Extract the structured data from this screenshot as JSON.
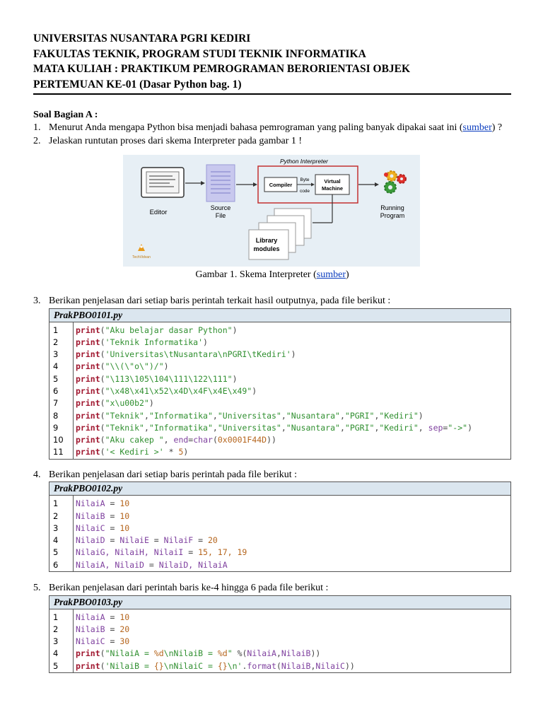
{
  "header": {
    "line1": "UNIVERSITAS NUSANTARA PGRI KEDIRI",
    "line2": "FAKULTAS TEKNIK, PROGRAM STUDI TEKNIK INFORMATIKA",
    "line3": "MATA KULIAH : PRAKTIKUM PEMROGRAMAN BERORIENTASI OBJEK",
    "line4": "PERTEMUAN KE-01 (Dasar Python bag. 1)"
  },
  "section_title": "Soal Bagian A :",
  "q1": {
    "num": "1.",
    "text": "Menurut Anda mengapa Python bisa menjadi bahasa pemrograman yang paling banyak dipakai saat ini (",
    "link": "sumber",
    "tail": ") ?"
  },
  "q2": {
    "num": "2.",
    "text": "Jelaskan runtutan proses dari skema Interpreter pada gambar 1 !"
  },
  "figure": {
    "title": "Python Interpreter",
    "editor": "Editor",
    "source": "Source",
    "file": "File",
    "compiler": "Compiler",
    "byte": "Byte",
    "code": "code",
    "virtual": "Virtual",
    "machine": "Machine",
    "running": "Running",
    "program": "Program",
    "library": "Library",
    "modules": "modules",
    "brand": "TechVidvan",
    "colors": {
      "gear1": "#e0302b",
      "gear2": "#3a9b3a",
      "gear3": "#f0b020",
      "bg": "#e7eff5",
      "box": "#c43030"
    }
  },
  "caption": {
    "text": "Gambar 1. Skema Interpreter (",
    "link": "sumber",
    "tail": ")"
  },
  "q3": {
    "num": "3.",
    "text": "Berikan penjelasan dari setiap baris perintah terkait hasil outputnya, pada file berikut :"
  },
  "q4": {
    "num": "4.",
    "text": "Berikan penjelasan dari setiap baris perintah pada file berikut :"
  },
  "q5": {
    "num": "5.",
    "text": "Berikan penjelasan dari perintah baris ke-4 hingga 6 pada file berikut :"
  },
  "code1": {
    "filename": "PrakPBO0101.py",
    "lines": [
      [
        "1",
        [
          [
            "kw",
            "print"
          ],
          [
            "op",
            "("
          ],
          [
            "str",
            "\"Aku belajar dasar Python\""
          ],
          [
            "op",
            ")"
          ]
        ]
      ],
      [
        "2",
        [
          [
            "kw",
            "print"
          ],
          [
            "op",
            "("
          ],
          [
            "str",
            "'Teknik Informatika'"
          ],
          [
            "op",
            ")"
          ]
        ]
      ],
      [
        "3",
        [
          [
            "kw",
            "print"
          ],
          [
            "op",
            "("
          ],
          [
            "str",
            "'Universitas\\tNusantara\\nPGRI\\tKediri'"
          ],
          [
            "op",
            ")"
          ]
        ]
      ],
      [
        "4",
        [
          [
            "kw",
            "print"
          ],
          [
            "op",
            "("
          ],
          [
            "str",
            "\"\\\\(\\\"o\\\")/\""
          ],
          [
            "op",
            ")"
          ]
        ]
      ],
      [
        "5",
        [
          [
            "kw",
            "print"
          ],
          [
            "op",
            "("
          ],
          [
            "str",
            "\"\\113\\105\\104\\111\\122\\111\""
          ],
          [
            "op",
            ")"
          ]
        ]
      ],
      [
        "6",
        [
          [
            "kw",
            "print"
          ],
          [
            "op",
            "("
          ],
          [
            "str",
            "\"\\x48\\x41\\x52\\x4D\\x4F\\x4E\\x49\""
          ],
          [
            "op",
            ")"
          ]
        ]
      ],
      [
        "7",
        [
          [
            "kw",
            "print"
          ],
          [
            "op",
            "("
          ],
          [
            "str",
            "\"x\\u00b2\""
          ],
          [
            "op",
            ")"
          ]
        ]
      ],
      [
        "8",
        [
          [
            "kw",
            "print"
          ],
          [
            "op",
            "("
          ],
          [
            "str",
            "\"Teknik\""
          ],
          [
            "op",
            ","
          ],
          [
            "str",
            "\"Informatika\""
          ],
          [
            "op",
            ","
          ],
          [
            "str",
            "\"Universitas\""
          ],
          [
            "op",
            ","
          ],
          [
            "str",
            "\"Nusantara\""
          ],
          [
            "op",
            ","
          ],
          [
            "str",
            "\"PGRI\""
          ],
          [
            "op",
            ","
          ],
          [
            "str",
            "\"Kediri\""
          ],
          [
            "op",
            ")"
          ]
        ]
      ],
      [
        "9",
        [
          [
            "kw",
            "print"
          ],
          [
            "op",
            "("
          ],
          [
            "str",
            "\"Teknik\""
          ],
          [
            "op",
            ","
          ],
          [
            "str",
            "\"Informatika\""
          ],
          [
            "op",
            ","
          ],
          [
            "str",
            "\"Universitas\""
          ],
          [
            "op",
            ","
          ],
          [
            "str",
            "\"Nusantara\""
          ],
          [
            "op",
            ","
          ],
          [
            "str",
            "\"PGRI\""
          ],
          [
            "op",
            ","
          ],
          [
            "str",
            "\"Kediri\""
          ],
          [
            "op",
            ", "
          ],
          [
            "var",
            "sep"
          ],
          [
            "op",
            "="
          ],
          [
            "str",
            "\"->\""
          ],
          [
            "op",
            ")"
          ]
        ]
      ],
      [
        "10",
        [
          [
            "kw",
            "print"
          ],
          [
            "op",
            "("
          ],
          [
            "str",
            "\"Aku cakep \""
          ],
          [
            "op",
            ", "
          ],
          [
            "var",
            "end"
          ],
          [
            "op",
            "="
          ],
          [
            "var",
            "char"
          ],
          [
            "op",
            "("
          ],
          [
            "numc",
            "0x0001F44D"
          ],
          [
            "op",
            "))"
          ]
        ]
      ],
      [
        "11",
        [
          [
            "kw",
            "print"
          ],
          [
            "op",
            "("
          ],
          [
            "str",
            "'< Kediri >'"
          ],
          [
            "op",
            " * "
          ],
          [
            "numc",
            "5"
          ],
          [
            "op",
            ")"
          ]
        ]
      ]
    ]
  },
  "code2": {
    "filename": "PrakPBO0102.py",
    "lines": [
      [
        "1",
        [
          [
            "var",
            "NilaiA"
          ],
          [
            "op",
            " = "
          ],
          [
            "numc",
            "10"
          ]
        ]
      ],
      [
        "2",
        [
          [
            "var",
            "NilaiB"
          ],
          [
            "op",
            " = "
          ],
          [
            "numc",
            "10"
          ]
        ]
      ],
      [
        "3",
        [
          [
            "var",
            "NilaiC"
          ],
          [
            "op",
            " = "
          ],
          [
            "numc",
            "10"
          ]
        ]
      ],
      [
        "4",
        [
          [
            "var",
            "NilaiD"
          ],
          [
            "op",
            " = "
          ],
          [
            "var",
            "NilaiE"
          ],
          [
            "op",
            " = "
          ],
          [
            "var",
            "NilaiF"
          ],
          [
            "op",
            " = "
          ],
          [
            "numc",
            "20"
          ]
        ]
      ],
      [
        "5",
        [
          [
            "var",
            "NilaiG, NilaiH, NilaiI"
          ],
          [
            "op",
            " = "
          ],
          [
            "numc",
            "15, 17, 19"
          ]
        ]
      ],
      [
        "6",
        [
          [
            "var",
            "NilaiA, NilaiD"
          ],
          [
            "op",
            " = "
          ],
          [
            "var",
            "NilaiD, NilaiA"
          ]
        ]
      ]
    ]
  },
  "code3": {
    "filename": "PrakPBO0103.py",
    "lines": [
      [
        "1",
        [
          [
            "var",
            "NilaiA"
          ],
          [
            "op",
            " = "
          ],
          [
            "numc",
            "10"
          ]
        ]
      ],
      [
        "2",
        [
          [
            "var",
            "NilaiB"
          ],
          [
            "op",
            " = "
          ],
          [
            "numc",
            "20"
          ]
        ]
      ],
      [
        "3",
        [
          [
            "var",
            "NilaiC"
          ],
          [
            "op",
            " = "
          ],
          [
            "numc",
            "30"
          ]
        ]
      ],
      [
        "4",
        [
          [
            "kw",
            "print"
          ],
          [
            "op",
            "("
          ],
          [
            "str",
            "\"NilaiA = "
          ],
          [
            "numc",
            "%d"
          ],
          [
            "str",
            "\\nNilaiB = "
          ],
          [
            "numc",
            "%d"
          ],
          [
            "str",
            "\""
          ],
          [
            "op",
            " %("
          ],
          [
            "var",
            "NilaiA"
          ],
          [
            "op",
            ","
          ],
          [
            "var",
            "NilaiB"
          ],
          [
            "op",
            "))"
          ]
        ]
      ],
      [
        "5",
        [
          [
            "kw",
            "print"
          ],
          [
            "op",
            "("
          ],
          [
            "str",
            "'NilaiB = "
          ],
          [
            "numc",
            "{}"
          ],
          [
            "str",
            "\\nNilaiC = "
          ],
          [
            "numc",
            "{}"
          ],
          [
            "str",
            "\\n'"
          ],
          [
            "op",
            "."
          ],
          [
            "var",
            "format"
          ],
          [
            "op",
            "("
          ],
          [
            "var",
            "NilaiB"
          ],
          [
            "op",
            ","
          ],
          [
            "var",
            "NilaiC"
          ],
          [
            "op",
            "))"
          ]
        ]
      ]
    ]
  }
}
